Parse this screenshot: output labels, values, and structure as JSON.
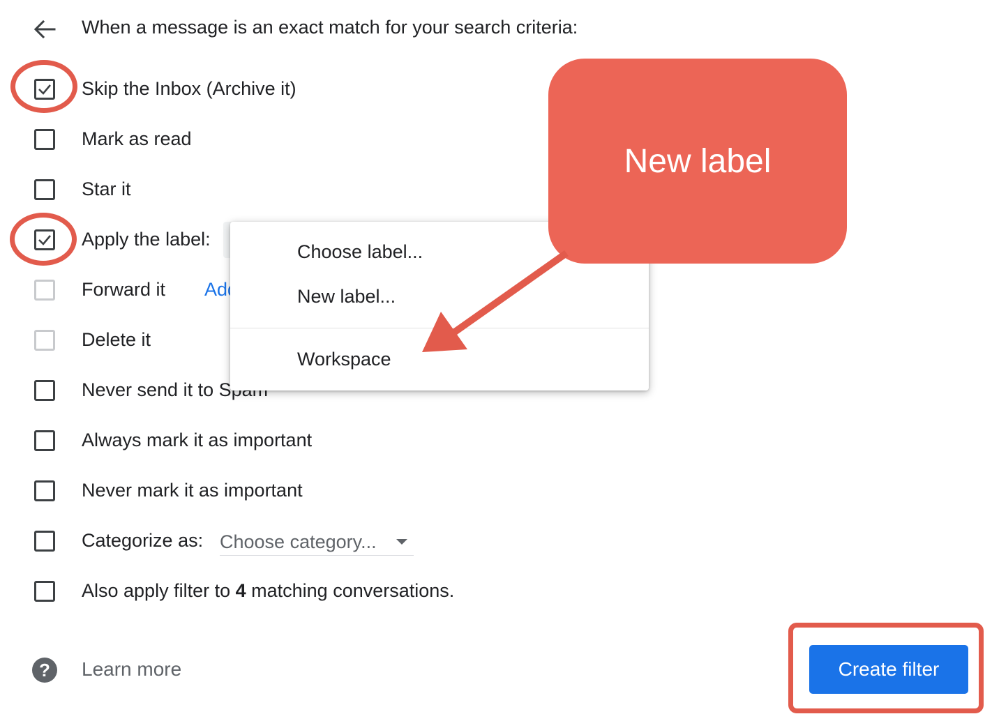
{
  "header": {
    "back_icon": "arrow-left-icon",
    "text": "When a message is an exact match for your search criteria:"
  },
  "options": [
    {
      "label": "Skip the Inbox (Archive it)",
      "checked": true,
      "enabled": true
    },
    {
      "label": "Mark as read",
      "checked": false,
      "enabled": true
    },
    {
      "label": "Star it",
      "checked": false,
      "enabled": true
    },
    {
      "label": "Apply the label:",
      "checked": true,
      "enabled": true
    },
    {
      "label": "Forward it",
      "checked": false,
      "enabled": false
    },
    {
      "label": "Delete it",
      "checked": false,
      "enabled": false
    },
    {
      "label": "Never send it to Spam",
      "checked": false,
      "enabled": true
    },
    {
      "label": "Always mark it as important",
      "checked": false,
      "enabled": true
    },
    {
      "label": "Never mark it as important",
      "checked": false,
      "enabled": true
    },
    {
      "label": "Categorize as:",
      "checked": false,
      "enabled": true
    },
    {
      "label_prefix": "Also apply filter to ",
      "label_count": "4",
      "label_suffix": " matching conversations.",
      "checked": false,
      "enabled": true
    }
  ],
  "forward_link": "Add forwarding address",
  "category_select": {
    "value": "Choose category...",
    "icon": "caret-down-icon"
  },
  "label_dropdown": {
    "items": [
      "Choose label...",
      "New label..."
    ],
    "labels": [
      "Workspace"
    ]
  },
  "callout": {
    "text": "New label",
    "color": "#ec6556"
  },
  "footer": {
    "help_icon": "question-mark-icon",
    "help_glyph": "?",
    "learn_more": "Learn more",
    "create_button": "Create filter"
  },
  "colors": {
    "accent": "#1a73e8",
    "annotation": "#e25b4c"
  }
}
